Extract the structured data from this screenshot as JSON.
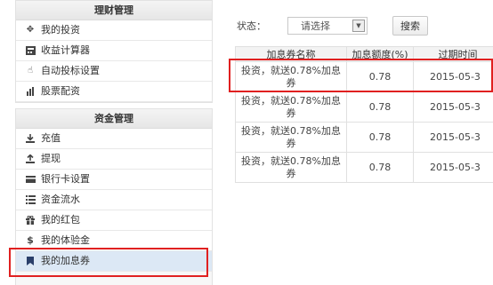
{
  "sidebar": {
    "finance": {
      "title": "理财管理",
      "items": [
        {
          "label": "我的投资",
          "icon": "move-icon"
        },
        {
          "label": "收益计算器",
          "icon": "calculator-icon"
        },
        {
          "label": "自动投标设置",
          "icon": "hand-icon"
        },
        {
          "label": "股票配资",
          "icon": "chart-icon"
        }
      ]
    },
    "funds": {
      "title": "资金管理",
      "items": [
        {
          "label": "充值",
          "icon": "download-icon"
        },
        {
          "label": "提现",
          "icon": "upload-icon"
        },
        {
          "label": "银行卡设置",
          "icon": "card-icon"
        },
        {
          "label": "资金流水",
          "icon": "list-icon"
        },
        {
          "label": "我的红包",
          "icon": "gift-icon"
        },
        {
          "label": "我的体验金",
          "icon": "dollar-icon"
        },
        {
          "label": "我的加息券",
          "icon": "bookmark-icon"
        }
      ]
    }
  },
  "filter": {
    "status_label": "状态：",
    "select_value": "请选择",
    "search_label": "搜索"
  },
  "table": {
    "headers": [
      "加息券名称",
      "加息额度(%)",
      "过期时间"
    ],
    "rows": [
      {
        "name": "投资，就送0.78%加息券",
        "rate": "0.78",
        "expire": "2015-05-3"
      },
      {
        "name": "投资，就送0.78%加息券",
        "rate": "0.78",
        "expire": "2015-05-3"
      },
      {
        "name": "投资，就送0.78%加息券",
        "rate": "0.78",
        "expire": "2015-05-3"
      },
      {
        "name": "投资，就送0.78%加息券",
        "rate": "0.78",
        "expire": "2015-05-3"
      }
    ]
  },
  "colors": {
    "highlight": "#e02020",
    "active_row": "#dce8f5"
  }
}
